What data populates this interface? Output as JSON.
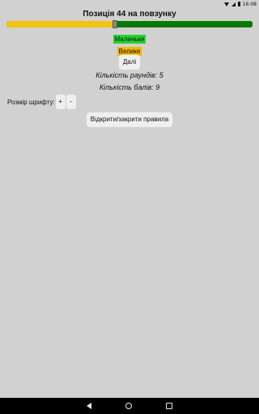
{
  "status_bar": {
    "time": "16:08",
    "icons": [
      "wifi-icon",
      "signal-icon",
      "battery-icon"
    ]
  },
  "title": "Позиція 44 на повзунку",
  "slider": {
    "value": 44,
    "min": 0,
    "max": 100,
    "left_color": "#f1c40f",
    "right_color": "#057a05"
  },
  "labels": {
    "small": "Маленьке",
    "small_color": "#22d32d",
    "big": "Велике",
    "big_color": "#f4b400"
  },
  "buttons": {
    "next": "Далі",
    "toggle_rules": "Відкрити/закрити правила"
  },
  "stats": {
    "rounds": "Кількість раундів: 5",
    "points": "Кількість балів: 9"
  },
  "font_size": {
    "label": "Розмір шрифту:",
    "plus": "+",
    "minus": "-"
  },
  "nav_bar": {
    "icons": [
      "back-icon",
      "home-icon",
      "recents-icon"
    ]
  }
}
